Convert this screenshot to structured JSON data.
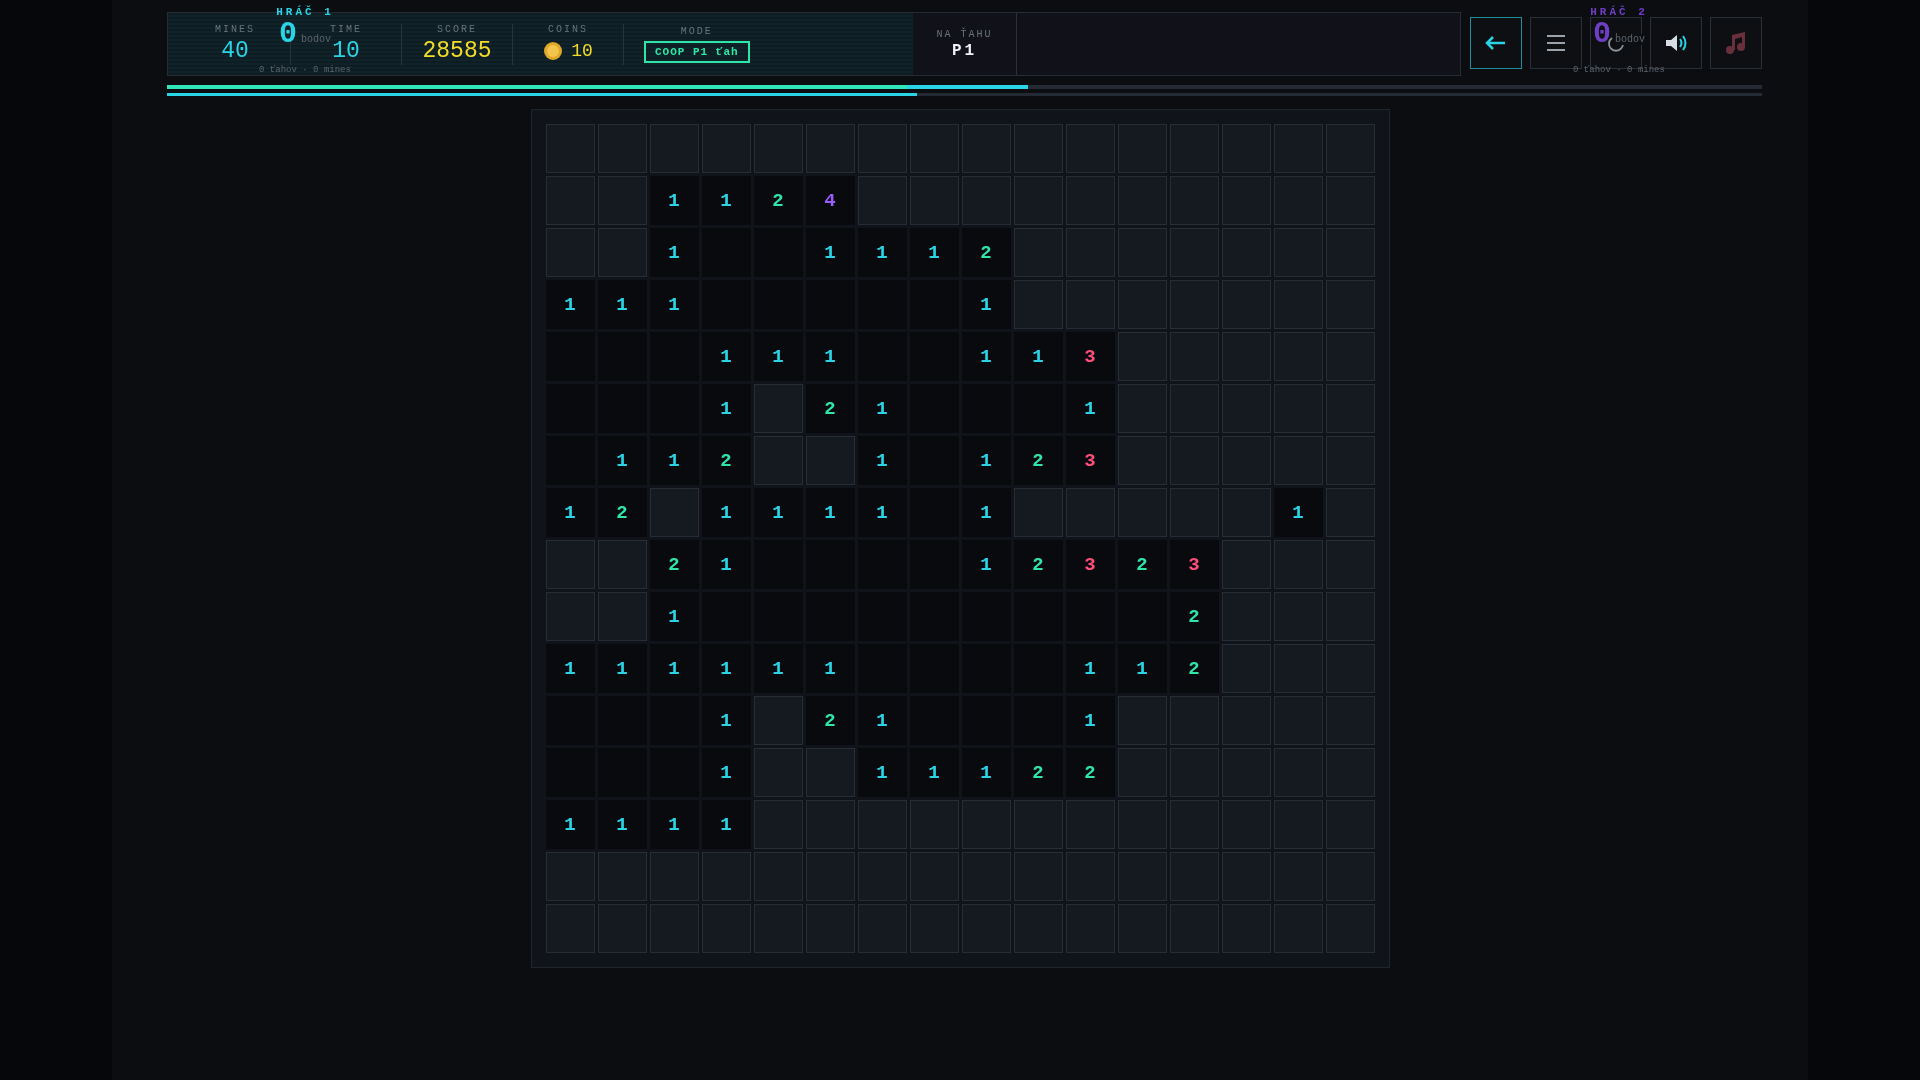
{
  "hud": {
    "stats": [
      {
        "kind": "plain",
        "label": "MINES",
        "value": "40"
      },
      {
        "kind": "plain",
        "label": "TIME",
        "value": "10"
      },
      {
        "kind": "score",
        "label": "SCORE",
        "value": "28585"
      },
      {
        "kind": "coins",
        "label": "COINS",
        "value": "10"
      },
      {
        "kind": "badge",
        "label": "MODE",
        "value": "COOP P1 ťah"
      }
    ],
    "turn": {
      "label": "NA ŤAHU",
      "value": "P1"
    },
    "players": [
      {
        "label": "HRÁČ 1",
        "score": "0",
        "unit": "bodov",
        "summary": "0 ťahov · 0 mines",
        "color": "#2ad4e6"
      },
      {
        "label": "HRÁČ 2",
        "score": "0",
        "unit": "bodov",
        "summary": "0 ťahov · 0 mines",
        "color": "#6e3fc4"
      }
    ],
    "buttons": [
      {
        "kind": "back"
      },
      {
        "kind": "menu"
      },
      {
        "kind": "restart"
      },
      {
        "kind": "sound"
      },
      {
        "kind": "music"
      }
    ],
    "progress": [
      {
        "level": 0.54
      },
      {
        "level": 0.47
      }
    ]
  },
  "board": {
    "rows": [
      [
        {
          "revealed": false
        },
        {
          "revealed": false
        },
        {
          "revealed": false
        },
        {
          "revealed": false
        },
        {
          "revealed": false
        },
        {
          "revealed": false
        },
        {
          "revealed": false
        },
        {
          "revealed": false
        },
        {
          "revealed": false
        },
        {
          "revealed": false
        },
        {
          "revealed": false
        },
        {
          "revealed": false
        },
        {
          "revealed": false
        },
        {
          "revealed": false
        },
        {
          "revealed": false
        },
        {
          "revealed": false
        }
      ],
      [
        {
          "revealed": false
        },
        {
          "revealed": false
        },
        {
          "revealed": true,
          "value": "1",
          "color": "#2ad4e6"
        },
        {
          "revealed": true,
          "value": "1",
          "color": "#2ad4e6"
        },
        {
          "revealed": true,
          "value": "2",
          "color": "#2ee6a6"
        },
        {
          "revealed": true,
          "value": "4",
          "color": "#9a5cff"
        },
        {
          "revealed": false
        },
        {
          "revealed": false
        },
        {
          "revealed": false
        },
        {
          "revealed": false
        },
        {
          "revealed": false
        },
        {
          "revealed": false
        },
        {
          "revealed": false
        },
        {
          "revealed": false
        },
        {
          "revealed": false
        },
        {
          "revealed": false
        }
      ],
      [
        {
          "revealed": false
        },
        {
          "revealed": false
        },
        {
          "revealed": true,
          "value": "1",
          "color": "#2ad4e6"
        },
        {
          "revealed": true
        },
        {
          "revealed": true
        },
        {
          "revealed": true,
          "value": "1",
          "color": "#2ad4e6"
        },
        {
          "revealed": true,
          "value": "1",
          "color": "#2ad4e6"
        },
        {
          "revealed": true,
          "value": "1",
          "color": "#2ad4e6"
        },
        {
          "revealed": true,
          "value": "2",
          "color": "#2ee6a6"
        },
        {
          "revealed": false
        },
        {
          "revealed": false
        },
        {
          "revealed": false
        },
        {
          "revealed": false
        },
        {
          "revealed": false
        },
        {
          "revealed": false
        },
        {
          "revealed": false
        }
      ],
      [
        {
          "revealed": true,
          "value": "1",
          "color": "#2ad4e6"
        },
        {
          "revealed": true,
          "value": "1",
          "color": "#2ad4e6"
        },
        {
          "revealed": true,
          "value": "1",
          "color": "#2ad4e6"
        },
        {
          "revealed": true
        },
        {
          "revealed": true
        },
        {
          "revealed": true
        },
        {
          "revealed": true
        },
        {
          "revealed": true
        },
        {
          "revealed": true,
          "value": "1",
          "color": "#2ad4e6"
        },
        {
          "revealed": false
        },
        {
          "revealed": false
        },
        {
          "revealed": false
        },
        {
          "revealed": false
        },
        {
          "revealed": false
        },
        {
          "revealed": false
        },
        {
          "revealed": false
        }
      ],
      [
        {
          "revealed": true
        },
        {
          "revealed": true
        },
        {
          "revealed": true
        },
        {
          "revealed": true,
          "value": "1",
          "color": "#2ad4e6"
        },
        {
          "revealed": true,
          "value": "1",
          "color": "#2ad4e6"
        },
        {
          "revealed": true,
          "value": "1",
          "color": "#2ad4e6"
        },
        {
          "revealed": true
        },
        {
          "revealed": true
        },
        {
          "revealed": true,
          "value": "1",
          "color": "#2ad4e6"
        },
        {
          "revealed": true,
          "value": "1",
          "color": "#2ad4e6"
        },
        {
          "revealed": true,
          "value": "3",
          "color": "#ff4d7a"
        },
        {
          "revealed": false
        },
        {
          "revealed": false
        },
        {
          "revealed": false
        },
        {
          "revealed": false
        },
        {
          "revealed": false
        }
      ],
      [
        {
          "revealed": true
        },
        {
          "revealed": true
        },
        {
          "revealed": true
        },
        {
          "revealed": true,
          "value": "1",
          "color": "#2ad4e6"
        },
        {
          "revealed": false
        },
        {
          "revealed": true,
          "value": "2",
          "color": "#2ee6a6"
        },
        {
          "revealed": true,
          "value": "1",
          "color": "#2ad4e6"
        },
        {
          "revealed": true
        },
        {
          "revealed": true
        },
        {
          "revealed": true
        },
        {
          "revealed": true,
          "value": "1",
          "color": "#2ad4e6"
        },
        {
          "revealed": false
        },
        {
          "revealed": false
        },
        {
          "revealed": false
        },
        {
          "revealed": false
        },
        {
          "revealed": false
        }
      ],
      [
        {
          "revealed": true
        },
        {
          "revealed": true,
          "value": "1",
          "color": "#2ad4e6"
        },
        {
          "revealed": true,
          "value": "1",
          "color": "#2ad4e6"
        },
        {
          "revealed": true,
          "value": "2",
          "color": "#2ee6a6"
        },
        {
          "revealed": false
        },
        {
          "revealed": false
        },
        {
          "revealed": true,
          "value": "1",
          "color": "#2ad4e6"
        },
        {
          "revealed": true
        },
        {
          "revealed": true,
          "value": "1",
          "color": "#2ad4e6"
        },
        {
          "revealed": true,
          "value": "2",
          "color": "#2ee6a6"
        },
        {
          "revealed": true,
          "value": "3",
          "color": "#ff4d7a"
        },
        {
          "revealed": false
        },
        {
          "revealed": false
        },
        {
          "revealed": false
        },
        {
          "revealed": false
        },
        {
          "revealed": false
        }
      ],
      [
        {
          "revealed": true,
          "value": "1",
          "color": "#2ad4e6"
        },
        {
          "revealed": true,
          "value": "2",
          "color": "#2ee6a6"
        },
        {
          "revealed": false
        },
        {
          "revealed": true,
          "value": "1",
          "color": "#2ad4e6"
        },
        {
          "revealed": true,
          "value": "1",
          "color": "#2ad4e6"
        },
        {
          "revealed": true,
          "value": "1",
          "color": "#2ad4e6"
        },
        {
          "revealed": true,
          "value": "1",
          "color": "#2ad4e6"
        },
        {
          "revealed": true
        },
        {
          "revealed": true,
          "value": "1",
          "color": "#2ad4e6"
        },
        {
          "revealed": false
        },
        {
          "revealed": false
        },
        {
          "revealed": false
        },
        {
          "revealed": false
        },
        {
          "revealed": false
        },
        {
          "revealed": true,
          "value": "1",
          "color": "#2ad4e6"
        },
        {
          "revealed": false
        }
      ],
      [
        {
          "revealed": false
        },
        {
          "revealed": false
        },
        {
          "revealed": true,
          "value": "2",
          "color": "#2ee6a6"
        },
        {
          "revealed": true,
          "value": "1",
          "color": "#2ad4e6"
        },
        {
          "revealed": true
        },
        {
          "revealed": true
        },
        {
          "revealed": true
        },
        {
          "revealed": true
        },
        {
          "revealed": true,
          "value": "1",
          "color": "#2ad4e6"
        },
        {
          "revealed": true,
          "value": "2",
          "color": "#2ee6a6"
        },
        {
          "revealed": true,
          "value": "3",
          "color": "#ff4d7a"
        },
        {
          "revealed": true,
          "value": "2",
          "color": "#2ee6a6"
        },
        {
          "revealed": true,
          "value": "3",
          "color": "#ff4d7a"
        },
        {
          "revealed": false
        },
        {
          "revealed": false
        },
        {
          "revealed": false
        }
      ],
      [
        {
          "revealed": false
        },
        {
          "revealed": false
        },
        {
          "revealed": true,
          "value": "1",
          "color": "#2ad4e6"
        },
        {
          "revealed": true
        },
        {
          "revealed": true
        },
        {
          "revealed": true
        },
        {
          "revealed": true
        },
        {
          "revealed": true
        },
        {
          "revealed": true
        },
        {
          "revealed": true
        },
        {
          "revealed": true
        },
        {
          "revealed": true
        },
        {
          "revealed": true,
          "value": "2",
          "color": "#2ee6a6"
        },
        {
          "revealed": false
        },
        {
          "revealed": false
        },
        {
          "revealed": false
        }
      ],
      [
        {
          "revealed": true,
          "value": "1",
          "color": "#2ad4e6"
        },
        {
          "revealed": true,
          "value": "1",
          "color": "#2ad4e6"
        },
        {
          "revealed": true,
          "value": "1",
          "color": "#2ad4e6"
        },
        {
          "revealed": true,
          "value": "1",
          "color": "#2ad4e6"
        },
        {
          "revealed": true,
          "value": "1",
          "color": "#2ad4e6"
        },
        {
          "revealed": true,
          "value": "1",
          "color": "#2ad4e6"
        },
        {
          "revealed": true
        },
        {
          "revealed": true
        },
        {
          "revealed": true
        },
        {
          "revealed": true
        },
        {
          "revealed": true,
          "value": "1",
          "color": "#2ad4e6"
        },
        {
          "revealed": true,
          "value": "1",
          "color": "#2ad4e6"
        },
        {
          "revealed": true,
          "value": "2",
          "color": "#2ee6a6"
        },
        {
          "revealed": false
        },
        {
          "revealed": false
        },
        {
          "revealed": false
        }
      ],
      [
        {
          "revealed": true
        },
        {
          "revealed": true
        },
        {
          "revealed": true
        },
        {
          "revealed": true,
          "value": "1",
          "color": "#2ad4e6"
        },
        {
          "revealed": false
        },
        {
          "revealed": true,
          "value": "2",
          "color": "#2ee6a6"
        },
        {
          "revealed": true,
          "value": "1",
          "color": "#2ad4e6"
        },
        {
          "revealed": true
        },
        {
          "revealed": true
        },
        {
          "revealed": true
        },
        {
          "revealed": true,
          "value": "1",
          "color": "#2ad4e6"
        },
        {
          "revealed": false
        },
        {
          "revealed": false
        },
        {
          "revealed": false
        },
        {
          "revealed": false
        },
        {
          "revealed": false
        }
      ],
      [
        {
          "revealed": true
        },
        {
          "revealed": true
        },
        {
          "revealed": true
        },
        {
          "revealed": true,
          "value": "1",
          "color": "#2ad4e6"
        },
        {
          "revealed": false
        },
        {
          "revealed": false
        },
        {
          "revealed": true,
          "value": "1",
          "color": "#2ad4e6"
        },
        {
          "revealed": true,
          "value": "1",
          "color": "#2ad4e6"
        },
        {
          "revealed": true,
          "value": "1",
          "color": "#2ad4e6"
        },
        {
          "revealed": true,
          "value": "2",
          "color": "#2ee6a6"
        },
        {
          "revealed": true,
          "value": "2",
          "color": "#2ee6a6"
        },
        {
          "revealed": false
        },
        {
          "revealed": false
        },
        {
          "revealed": false
        },
        {
          "revealed": false
        },
        {
          "revealed": false
        }
      ],
      [
        {
          "revealed": true,
          "value": "1",
          "color": "#2ad4e6"
        },
        {
          "revealed": true,
          "value": "1",
          "color": "#2ad4e6"
        },
        {
          "revealed": true,
          "value": "1",
          "color": "#2ad4e6"
        },
        {
          "revealed": true,
          "value": "1",
          "color": "#2ad4e6"
        },
        {
          "revealed": false
        },
        {
          "revealed": false
        },
        {
          "revealed": false
        },
        {
          "revealed": false
        },
        {
          "revealed": false
        },
        {
          "revealed": false
        },
        {
          "revealed": false
        },
        {
          "revealed": false
        },
        {
          "revealed": false
        },
        {
          "revealed": false
        },
        {
          "revealed": false
        },
        {
          "revealed": false
        }
      ],
      [
        {
          "revealed": false
        },
        {
          "revealed": false
        },
        {
          "revealed": false
        },
        {
          "revealed": false
        },
        {
          "revealed": false
        },
        {
          "revealed": false
        },
        {
          "revealed": false
        },
        {
          "revealed": false
        },
        {
          "revealed": false
        },
        {
          "revealed": false
        },
        {
          "revealed": false
        },
        {
          "revealed": false
        },
        {
          "revealed": false
        },
        {
          "revealed": false
        },
        {
          "revealed": false
        },
        {
          "revealed": false
        }
      ],
      [
        {
          "revealed": false
        },
        {
          "revealed": false
        },
        {
          "revealed": false
        },
        {
          "revealed": false
        },
        {
          "revealed": false
        },
        {
          "revealed": false
        },
        {
          "revealed": false
        },
        {
          "revealed": false
        },
        {
          "revealed": false
        },
        {
          "revealed": false
        },
        {
          "revealed": false
        },
        {
          "revealed": false
        },
        {
          "revealed": false
        },
        {
          "revealed": false
        },
        {
          "revealed": false
        },
        {
          "revealed": false
        }
      ]
    ]
  }
}
